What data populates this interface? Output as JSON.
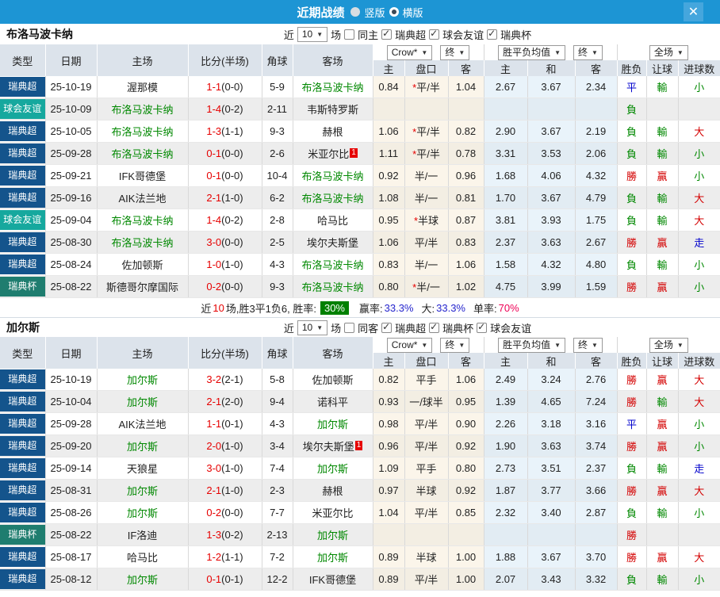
{
  "colors": {
    "titlebar_bg": "#1d95d4",
    "team_green": "#008800",
    "score_red": "#e60000",
    "league_colors": {
      "瑞典超": "#14548c",
      "球会友谊": "#16a89e",
      "瑞典杯": "#1f7d6f"
    }
  },
  "result_colors": {
    "勝": "#d40000",
    "贏": "#d40000",
    "大": "#d40000",
    "負": "#008800",
    "輸": "#008800",
    "小": "#008800",
    "平": "#0000cc",
    "走": "#0000cc"
  },
  "titlebar": {
    "title": "近期战绩",
    "radio_options": [
      {
        "label": "竖版",
        "selected": false
      },
      {
        "label": "横版",
        "selected": true
      }
    ],
    "close_icon": "✕"
  },
  "table_header": {
    "col_type": "类型",
    "col_date": "日期",
    "col_home": "主场",
    "col_score": "比分(半场)",
    "col_corner": "角球",
    "col_away": "客场",
    "dd_bookmaker": "Crow*",
    "dd_final1": "终",
    "dd_avg": "胜平负均值",
    "dd_final2": "终",
    "dd_fullmatch": "全场",
    "sub_home_odds": "主",
    "sub_handicap": "盘口",
    "sub_away_odds": "客",
    "sub_home_avg": "主",
    "sub_draw_avg": "和",
    "sub_away_avg": "客",
    "sub_winloss": "胜负",
    "sub_handicap_res": "让球",
    "sub_goals": "进球数"
  },
  "sections": [
    {
      "team": "布洛马波卡纳",
      "filter": {
        "near_label": "近",
        "count": "10",
        "games_label": "场",
        "same_label": "同主",
        "same_checked": false,
        "leagues": [
          {
            "label": "瑞典超",
            "checked": true
          },
          {
            "label": "球会友谊",
            "checked": true
          },
          {
            "label": "瑞典杯",
            "checked": true
          }
        ]
      },
      "rows": [
        {
          "league": "瑞典超",
          "date": "25-10-19",
          "home": "渥那模",
          "home_focus": false,
          "score_ft": "1-1",
          "score_ht": "(0-0)",
          "corner": "5-9",
          "away": "布洛马波卡纳",
          "away_focus": true,
          "away_badge": "",
          "odds": [
            "0.84",
            "*平/半",
            "1.04"
          ],
          "avg": [
            "2.67",
            "3.67",
            "2.34"
          ],
          "results": [
            "平",
            "輸",
            "小"
          ]
        },
        {
          "league": "球会友谊",
          "date": "25-10-09",
          "home": "布洛马波卡纳",
          "home_focus": true,
          "score_ft": "1-4",
          "score_ht": "(0-2)",
          "corner": "2-11",
          "away": "韦斯特罗斯",
          "away_focus": false,
          "away_badge": "",
          "odds": [
            "",
            "",
            ""
          ],
          "avg": [
            "",
            "",
            ""
          ],
          "results": [
            "負",
            "",
            ""
          ]
        },
        {
          "league": "瑞典超",
          "date": "25-10-05",
          "home": "布洛马波卡纳",
          "home_focus": true,
          "score_ft": "1-3",
          "score_ht": "(1-1)",
          "corner": "9-3",
          "away": "赫根",
          "away_focus": false,
          "away_badge": "",
          "odds": [
            "1.06",
            "*平/半",
            "0.82"
          ],
          "avg": [
            "2.90",
            "3.67",
            "2.19"
          ],
          "results": [
            "負",
            "輸",
            "大"
          ]
        },
        {
          "league": "瑞典超",
          "date": "25-09-28",
          "home": "布洛马波卡纳",
          "home_focus": true,
          "score_ft": "0-1",
          "score_ht": "(0-0)",
          "corner": "2-6",
          "away": "米亚尔比",
          "away_focus": false,
          "away_badge": "1",
          "odds": [
            "1.11",
            "*平/半",
            "0.78"
          ],
          "avg": [
            "3.31",
            "3.53",
            "2.06"
          ],
          "results": [
            "負",
            "輸",
            "小"
          ]
        },
        {
          "league": "瑞典超",
          "date": "25-09-21",
          "home": "IFK哥德堡",
          "home_focus": false,
          "score_ft": "0-1",
          "score_ht": "(0-0)",
          "corner": "10-4",
          "away": "布洛马波卡纳",
          "away_focus": true,
          "away_badge": "",
          "odds": [
            "0.92",
            "半/一",
            "0.96"
          ],
          "avg": [
            "1.68",
            "4.06",
            "4.32"
          ],
          "results": [
            "勝",
            "贏",
            "小"
          ]
        },
        {
          "league": "瑞典超",
          "date": "25-09-16",
          "home": "AIK法兰地",
          "home_focus": false,
          "score_ft": "2-1",
          "score_ht": "(1-0)",
          "corner": "6-2",
          "away": "布洛马波卡纳",
          "away_focus": true,
          "away_badge": "",
          "odds": [
            "1.08",
            "半/一",
            "0.81"
          ],
          "avg": [
            "1.70",
            "3.67",
            "4.79"
          ],
          "results": [
            "負",
            "輸",
            "大"
          ]
        },
        {
          "league": "球会友谊",
          "date": "25-09-04",
          "home": "布洛马波卡纳",
          "home_focus": true,
          "score_ft": "1-4",
          "score_ht": "(0-2)",
          "corner": "2-8",
          "away": "哈马比",
          "away_focus": false,
          "away_badge": "",
          "odds": [
            "0.95",
            "*半球",
            "0.87"
          ],
          "avg": [
            "3.81",
            "3.93",
            "1.75"
          ],
          "results": [
            "負",
            "輸",
            "大"
          ]
        },
        {
          "league": "瑞典超",
          "date": "25-08-30",
          "home": "布洛马波卡纳",
          "home_focus": true,
          "score_ft": "3-0",
          "score_ht": "(0-0)",
          "corner": "2-5",
          "away": "埃尔夫斯堡",
          "away_focus": false,
          "away_badge": "",
          "odds": [
            "1.06",
            "平/半",
            "0.83"
          ],
          "avg": [
            "2.37",
            "3.63",
            "2.67"
          ],
          "results": [
            "勝",
            "贏",
            "走"
          ]
        },
        {
          "league": "瑞典超",
          "date": "25-08-24",
          "home": "佐加顿斯",
          "home_focus": false,
          "score_ft": "1-0",
          "score_ht": "(1-0)",
          "corner": "4-3",
          "away": "布洛马波卡纳",
          "away_focus": true,
          "away_badge": "",
          "odds": [
            "0.83",
            "半/一",
            "1.06"
          ],
          "avg": [
            "1.58",
            "4.32",
            "4.80"
          ],
          "results": [
            "負",
            "輸",
            "小"
          ]
        },
        {
          "league": "瑞典杯",
          "date": "25-08-22",
          "home": "斯德哥尔摩国际",
          "home_focus": false,
          "score_ft": "0-2",
          "score_ht": "(0-0)",
          "corner": "9-3",
          "away": "布洛马波卡纳",
          "away_focus": true,
          "away_badge": "",
          "odds": [
            "0.80",
            "*半/一",
            "1.02"
          ],
          "avg": [
            "4.75",
            "3.99",
            "1.59"
          ],
          "results": [
            "勝",
            "贏",
            "小"
          ]
        }
      ],
      "summary": {
        "text_pre": "近",
        "games": "10",
        "text_mid": "场,胜3平1负6, 胜率:",
        "win_rate": "30%",
        "win_label": "赢率:",
        "win_pct": "33.3%",
        "big_label": "大:",
        "big_pct": "33.3%",
        "single_label": "单率:",
        "single_pct": "70%"
      }
    },
    {
      "team": "加尔斯",
      "filter": {
        "near_label": "近",
        "count": "10",
        "games_label": "场",
        "same_label": "同客",
        "same_checked": false,
        "leagues": [
          {
            "label": "瑞典超",
            "checked": true
          },
          {
            "label": "瑞典杯",
            "checked": true
          },
          {
            "label": "球会友谊",
            "checked": true
          }
        ]
      },
      "rows": [
        {
          "league": "瑞典超",
          "date": "25-10-19",
          "home": "加尔斯",
          "home_focus": true,
          "score_ft": "3-2",
          "score_ht": "(2-1)",
          "corner": "5-8",
          "away": "佐加顿斯",
          "away_focus": false,
          "away_badge": "",
          "odds": [
            "0.82",
            "平手",
            "1.06"
          ],
          "avg": [
            "2.49",
            "3.24",
            "2.76"
          ],
          "results": [
            "勝",
            "贏",
            "大"
          ]
        },
        {
          "league": "瑞典超",
          "date": "25-10-04",
          "home": "加尔斯",
          "home_focus": true,
          "score_ft": "2-1",
          "score_ht": "(2-0)",
          "corner": "9-4",
          "away": "诺科平",
          "away_focus": false,
          "away_badge": "",
          "odds": [
            "0.93",
            "一/球半",
            "0.95"
          ],
          "avg": [
            "1.39",
            "4.65",
            "7.24"
          ],
          "results": [
            "勝",
            "輸",
            "大"
          ]
        },
        {
          "league": "瑞典超",
          "date": "25-09-28",
          "home": "AIK法兰地",
          "home_focus": false,
          "score_ft": "1-1",
          "score_ht": "(0-1)",
          "corner": "4-3",
          "away": "加尔斯",
          "away_focus": true,
          "away_badge": "",
          "odds": [
            "0.98",
            "平/半",
            "0.90"
          ],
          "avg": [
            "2.26",
            "3.18",
            "3.16"
          ],
          "results": [
            "平",
            "贏",
            "小"
          ]
        },
        {
          "league": "瑞典超",
          "date": "25-09-20",
          "home": "加尔斯",
          "home_focus": true,
          "score_ft": "2-0",
          "score_ht": "(1-0)",
          "corner": "3-4",
          "away": "埃尔夫斯堡",
          "away_focus": false,
          "away_badge": "1",
          "odds": [
            "0.96",
            "平/半",
            "0.92"
          ],
          "avg": [
            "1.90",
            "3.63",
            "3.74"
          ],
          "results": [
            "勝",
            "贏",
            "小"
          ]
        },
        {
          "league": "瑞典超",
          "date": "25-09-14",
          "home": "天狼星",
          "home_focus": false,
          "score_ft": "3-0",
          "score_ht": "(1-0)",
          "corner": "7-4",
          "away": "加尔斯",
          "away_focus": true,
          "away_badge": "",
          "odds": [
            "1.09",
            "平手",
            "0.80"
          ],
          "avg": [
            "2.73",
            "3.51",
            "2.37"
          ],
          "results": [
            "負",
            "輸",
            "走"
          ]
        },
        {
          "league": "瑞典超",
          "date": "25-08-31",
          "home": "加尔斯",
          "home_focus": true,
          "score_ft": "2-1",
          "score_ht": "(1-0)",
          "corner": "2-3",
          "away": "赫根",
          "away_focus": false,
          "away_badge": "",
          "odds": [
            "0.97",
            "半球",
            "0.92"
          ],
          "avg": [
            "1.87",
            "3.77",
            "3.66"
          ],
          "results": [
            "勝",
            "贏",
            "大"
          ]
        },
        {
          "league": "瑞典超",
          "date": "25-08-26",
          "home": "加尔斯",
          "home_focus": true,
          "score_ft": "0-2",
          "score_ht": "(0-0)",
          "corner": "7-7",
          "away": "米亚尔比",
          "away_focus": false,
          "away_badge": "",
          "odds": [
            "1.04",
            "平/半",
            "0.85"
          ],
          "avg": [
            "2.32",
            "3.40",
            "2.87"
          ],
          "results": [
            "負",
            "輸",
            "小"
          ]
        },
        {
          "league": "瑞典杯",
          "date": "25-08-22",
          "home": "IF洛迪",
          "home_focus": false,
          "score_ft": "1-3",
          "score_ht": "(0-2)",
          "corner": "2-13",
          "away": "加尔斯",
          "away_focus": true,
          "away_badge": "",
          "odds": [
            "",
            "",
            ""
          ],
          "avg": [
            "",
            "",
            ""
          ],
          "results": [
            "勝",
            "",
            ""
          ]
        },
        {
          "league": "瑞典超",
          "date": "25-08-17",
          "home": "哈马比",
          "home_focus": false,
          "score_ft": "1-2",
          "score_ht": "(1-1)",
          "corner": "7-2",
          "away": "加尔斯",
          "away_focus": true,
          "away_badge": "",
          "odds": [
            "0.89",
            "半球",
            "1.00"
          ],
          "avg": [
            "1.88",
            "3.67",
            "3.70"
          ],
          "results": [
            "勝",
            "贏",
            "大"
          ]
        },
        {
          "league": "瑞典超",
          "date": "25-08-12",
          "home": "加尔斯",
          "home_focus": true,
          "score_ft": "0-1",
          "score_ht": "(0-1)",
          "corner": "12-2",
          "away": "IFK哥德堡",
          "away_focus": false,
          "away_badge": "",
          "odds": [
            "0.89",
            "平/半",
            "1.00"
          ],
          "avg": [
            "2.07",
            "3.43",
            "3.32"
          ],
          "results": [
            "負",
            "輸",
            "小"
          ]
        }
      ]
    }
  ]
}
